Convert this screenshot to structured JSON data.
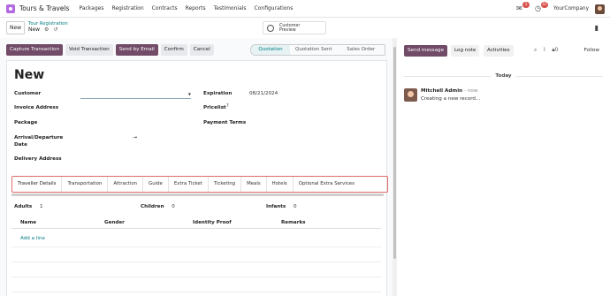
{
  "navbar": {
    "app_name": "Tours & Travels",
    "menu": [
      "Packages",
      "Registration",
      "Contracts",
      "Reports",
      "Testimonials",
      "Configurations"
    ],
    "messages_badge": "1",
    "activities_badge": "37",
    "company": "YourCompany"
  },
  "control": {
    "new_label": "New",
    "breadcrumb_parent": "Tour Registration",
    "breadcrumb_current": "New",
    "preview_label_line1": "Customer",
    "preview_label_line2": "Preview"
  },
  "statusbar": {
    "buttons": [
      "Capture Transaction",
      "Void Transaction",
      "Send by Email",
      "Confirm",
      "Cancel"
    ],
    "stages": [
      "Quotation",
      "Quotation Sent",
      "Sales Order"
    ],
    "active_stage": "Quotation"
  },
  "form": {
    "title": "New",
    "customer_label": "Customer",
    "invoice_label": "Invoice Address",
    "package_label": "Package",
    "arrival_label_1": "Arrival/Departure",
    "arrival_label_2": "Date",
    "delivery_label": "Delivery Address",
    "expiration_label": "Expiration",
    "expiration_value": "08/21/2024",
    "pricelist_label": "Pricelist",
    "pricelist_req": "?",
    "payment_terms_label": "Payment Terms",
    "arrow": "→"
  },
  "tabs": [
    "Traveller Details",
    "Transportation",
    "Attraction",
    "Guide",
    "Extra Ticket",
    "Ticketing",
    "Meals",
    "Hotels",
    "Optional Extra Services"
  ],
  "passengers": {
    "adults_label": "Adults",
    "adults_value": "1",
    "children_label": "Children",
    "children_value": "0",
    "infants_label": "Infants",
    "infants_value": "0"
  },
  "table": {
    "headers": [
      "Name",
      "Gender",
      "Identity Proof",
      "Remarks"
    ],
    "add_line": "Add a line"
  },
  "chatter": {
    "send_message": "Send message",
    "log_note": "Log note",
    "activities": "Activities",
    "follow": "Follow",
    "follower_count": "0",
    "today": "Today",
    "author": "Mitchell Admin",
    "time": "- now",
    "body": "Creating a new record..."
  },
  "icons": {
    "app": "apps-icon",
    "messages": "chat-icon",
    "activities": "clock-icon",
    "gear": "gear-icon",
    "discard": "undo-icon",
    "globe": "globe-icon",
    "search": "search-icon",
    "attach": "paperclip-icon",
    "lock": "lock-icon"
  },
  "colors": {
    "primary": "#714b67",
    "link": "#017e84",
    "badge": "#d9534f",
    "tabs_border": "#e06b6b"
  }
}
